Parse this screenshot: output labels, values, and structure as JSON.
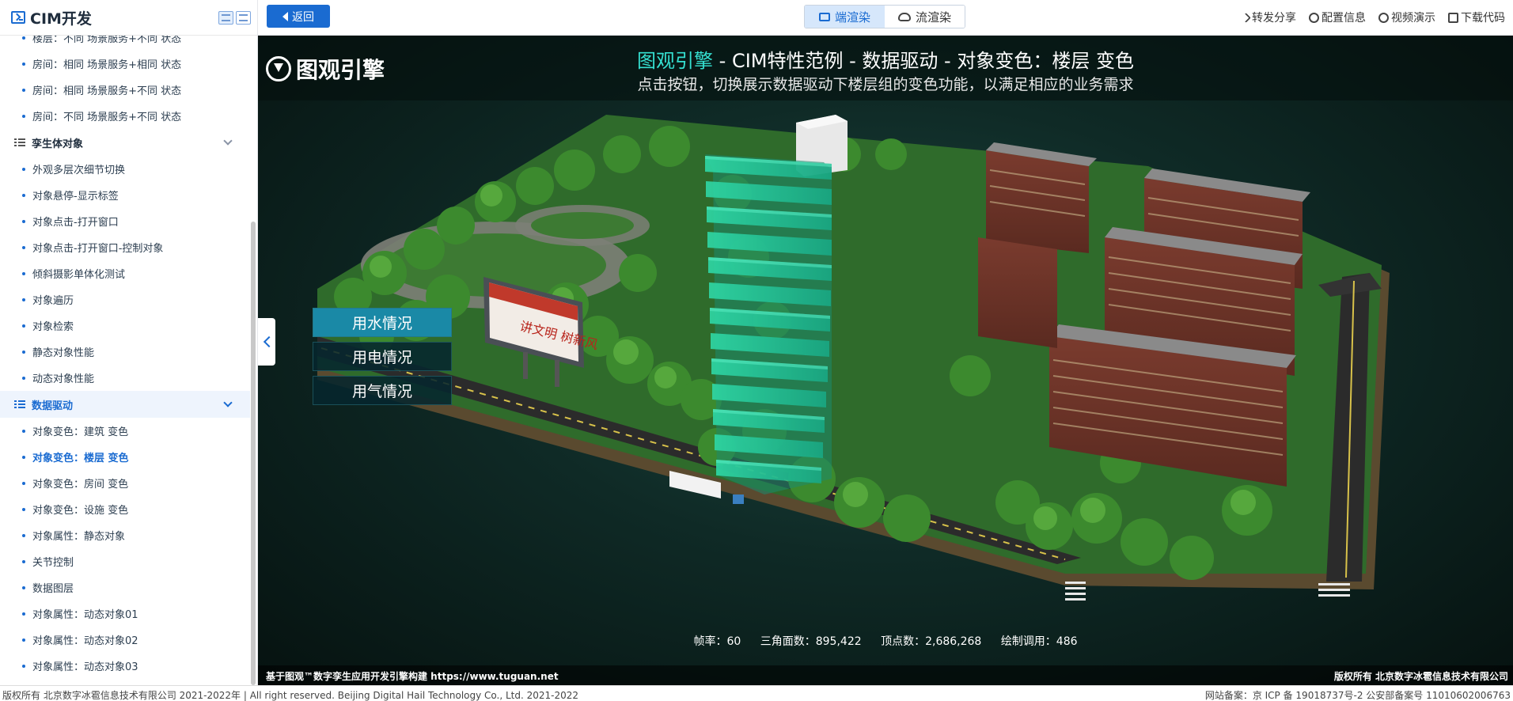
{
  "sidebar": {
    "title": "CIM开发",
    "items_top": [
      {
        "label": "楼层：不同 场景服务+不同 状态"
      },
      {
        "label": "房间：相同 场景服务+相同 状态"
      },
      {
        "label": "房间：相同 场景服务+不同 状态"
      },
      {
        "label": "房间：不同 场景服务+不同 状态"
      }
    ],
    "group_twin": "孪生体对象",
    "items_twin": [
      {
        "label": "外观多层次细节切换"
      },
      {
        "label": "对象悬停-显示标签"
      },
      {
        "label": "对象点击-打开窗口"
      },
      {
        "label": "对象点击-打开窗口-控制对象"
      },
      {
        "label": "倾斜摄影单体化测试"
      },
      {
        "label": "对象遍历"
      },
      {
        "label": "对象检索"
      },
      {
        "label": "静态对象性能"
      },
      {
        "label": "动态对象性能"
      }
    ],
    "group_data": "数据驱动",
    "items_data": [
      {
        "label": "对象变色：建筑 变色"
      },
      {
        "label": "对象变色：楼层 变色"
      },
      {
        "label": "对象变色：房间 变色"
      },
      {
        "label": "对象变色：设施 变色"
      },
      {
        "label": "对象属性：静态对象"
      },
      {
        "label": "关节控制"
      },
      {
        "label": "数据图层"
      },
      {
        "label": "对象属性：动态对象01"
      },
      {
        "label": "对象属性：动态对象02"
      },
      {
        "label": "对象属性：动态对象03"
      }
    ]
  },
  "toolbar": {
    "back_label": "返回",
    "tab_client": "端渲染",
    "tab_stream": "流渲染",
    "links": {
      "share": "转发分享",
      "config": "配置信息",
      "video": "视频演示",
      "download": "下载代码"
    }
  },
  "viewport": {
    "brand": "图观引擎",
    "title_accent": "图观引擎",
    "title_rest": " - CIM特性范例 - 数据驱动 - 对象变色：楼层 变色",
    "subtitle": "点击按钮，切换展示数据驱动下楼层组的变色功能，以满足相应的业务需求",
    "billboard_text": "讲文明 树新风",
    "buttons": [
      "用水情况",
      "用电情况",
      "用气情况"
    ],
    "stats": {
      "fps": "帧率：60",
      "triangles": "三角面数：895,422",
      "vertices": "顶点数：2,686,268",
      "draw_calls": "绘制调用：486"
    },
    "footer_left": "基于图观™数字孪生应用开发引擎构建 https://www.tuguan.net",
    "footer_right": "版权所有 北京数字冰雹信息技术有限公司"
  },
  "page_footer": {
    "left": "版权所有 北京数字冰雹信息技术有限公司 2021-2022年 | All right reserved. Beijing Digital Hail Technology Co., Ltd. 2021-2022",
    "right": "网站备案：京 ICP 备 19018737号-2 公安部备案号 11010602006763"
  },
  "colors": {
    "accent": "#1a6bd1",
    "highlight_floor": "#3fe0b4",
    "title_accent": "#35e0d1"
  }
}
